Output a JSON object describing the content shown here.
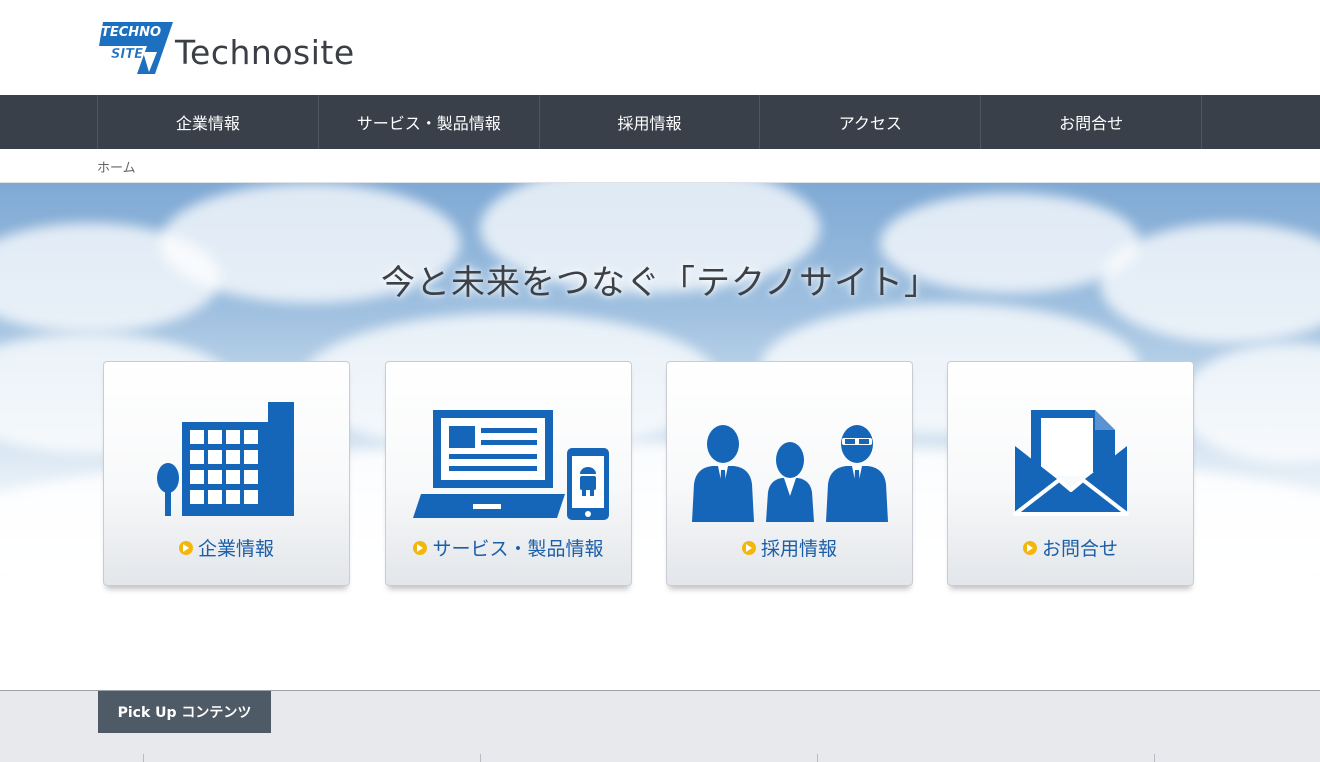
{
  "header": {
    "logo_mark_line1": "TECHNO",
    "logo_mark_line2": "SITE",
    "logo_text": "Technosite"
  },
  "nav": {
    "items": [
      {
        "label": "企業情報"
      },
      {
        "label": "サービス・製品情報"
      },
      {
        "label": "採用情報"
      },
      {
        "label": "アクセス"
      },
      {
        "label": "お問合せ"
      }
    ]
  },
  "breadcrumb": {
    "home": "ホーム"
  },
  "hero": {
    "title": "今と未来をつなぐ「テクノサイト」",
    "cards": [
      {
        "label": "企業情報",
        "icon": "building-icon"
      },
      {
        "label": "サービス・製品情報",
        "icon": "laptop-smartphone-icon"
      },
      {
        "label": "採用情報",
        "icon": "people-icon"
      },
      {
        "label": "お問合せ",
        "icon": "envelope-icon"
      }
    ]
  },
  "pickup": {
    "tab_label": "Pick Up コンテンツ"
  },
  "colors": {
    "nav_bg": "#394049",
    "icon_blue": "#1565b8",
    "label_blue": "#1a5fa8",
    "bullet_yellow": "#f2b70d",
    "pickup_tab_bg": "#4e5a66"
  }
}
